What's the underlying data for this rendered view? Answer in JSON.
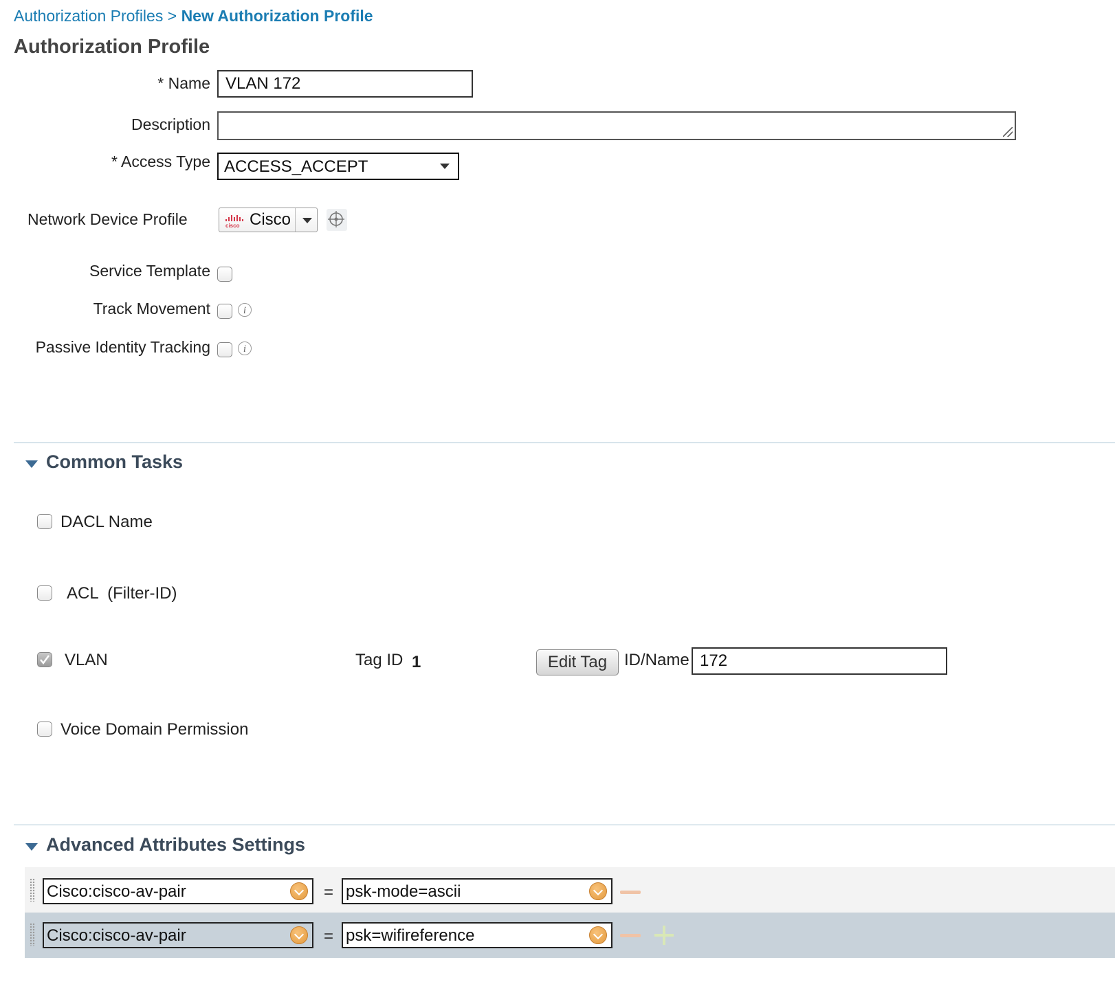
{
  "breadcrumb": {
    "parent": "Authorization Profiles",
    "separator": ">",
    "current": "New Authorization Profile"
  },
  "page_title": "Authorization Profile",
  "form": {
    "name_label": "* Name",
    "name_value": "VLAN 172",
    "description_label": "Description",
    "description_value": "",
    "access_type_label": "* Access Type",
    "access_type_value": "ACCESS_ACCEPT",
    "network_device_profile_label": "Network Device Profile",
    "network_device_profile_value": "Cisco",
    "network_device_profile_logo": "cisco",
    "service_template_label": "Service Template",
    "service_template_checked": false,
    "track_movement_label": "Track Movement",
    "track_movement_checked": false,
    "passive_identity_tracking_label": "Passive Identity Tracking",
    "passive_identity_tracking_checked": false
  },
  "common_tasks": {
    "title": "Common Tasks",
    "dacl_name_label": "DACL Name",
    "acl_label": "ACL  (Filter-ID)",
    "vlan_label": "VLAN",
    "vlan_checked": true,
    "tag_id_label": "Tag ID",
    "tag_id_value": "1",
    "edit_tag_label": "Edit Tag",
    "id_name_label": "ID/Name",
    "id_name_value": "172",
    "voice_domain_label": "Voice Domain Permission"
  },
  "advanced": {
    "title": "Advanced Attributes Settings",
    "rows": [
      {
        "attribute": "Cisco:cisco-av-pair",
        "operator": "=",
        "value": "psk-mode=ascii"
      },
      {
        "attribute": "Cisco:cisco-av-pair",
        "operator": "=",
        "value": "psk=wifireference"
      }
    ]
  },
  "colors": {
    "link": "#1b7db3",
    "section_title": "#3b4a5a",
    "divider": "#a9c3d4",
    "row_highlight": "#c8d2da"
  }
}
